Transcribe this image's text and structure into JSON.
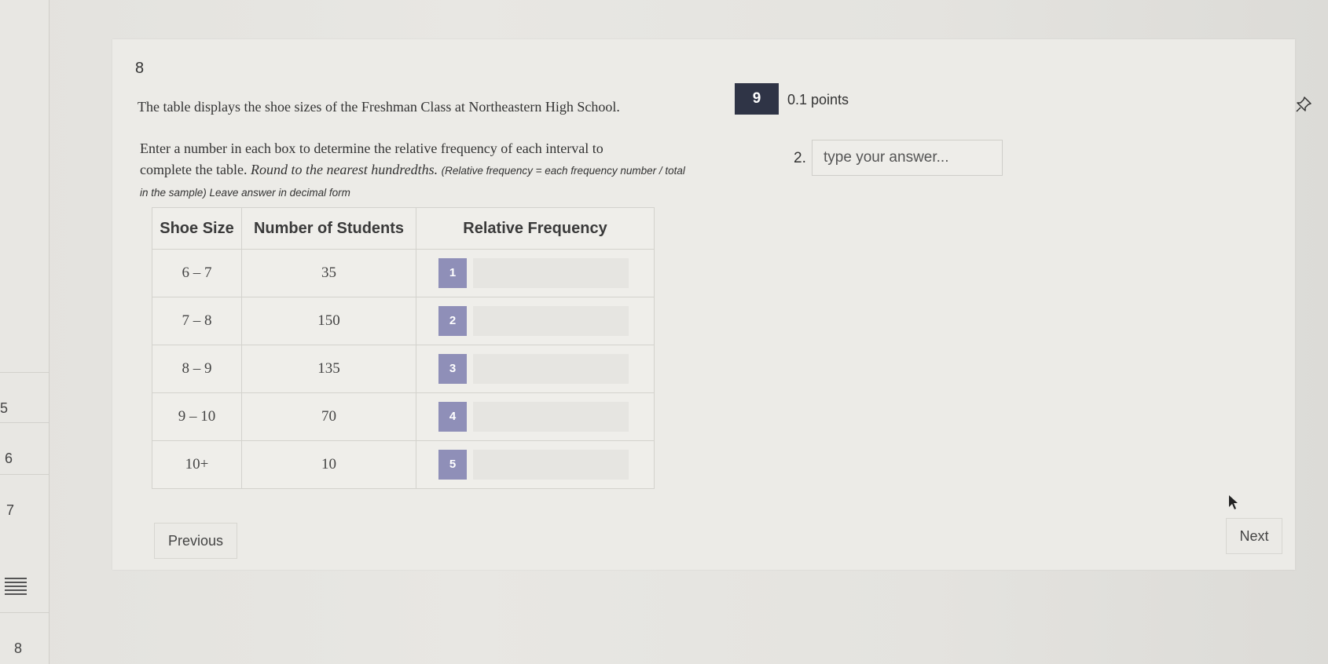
{
  "rail": {
    "items": [
      {
        "label": "5"
      },
      {
        "label": "6"
      },
      {
        "label": "7"
      },
      {
        "label": "8"
      }
    ]
  },
  "question": {
    "number": "8",
    "stem": "The table displays the shoe sizes of the Freshman Class at Northeastern High School.",
    "instructions_line1": "Enter a number in each box to determine the relative frequency of each interval to",
    "instructions_line2_plain": "complete the table. ",
    "instructions_line2_italic": "Round to the nearest hundredths.",
    "instructions_note": "(Relative frequency = each frequency number / total in the sample) Leave answer in decimal form"
  },
  "table": {
    "headers": [
      "Shoe Size",
      "Number of Students",
      "Relative Frequency"
    ],
    "rows": [
      {
        "size": "6 – 7",
        "students": "35",
        "blank": "1"
      },
      {
        "size": "7 – 8",
        "students": "150",
        "blank": "2"
      },
      {
        "size": "8 – 9",
        "students": "135",
        "blank": "3"
      },
      {
        "size": "9 – 10",
        "students": "70",
        "blank": "4"
      },
      {
        "size": "10+",
        "students": "10",
        "blank": "5"
      }
    ]
  },
  "next_question": {
    "number": "9",
    "points": "0.1 points",
    "answer_index": "2.",
    "answer_placeholder": "type your answer..."
  },
  "nav": {
    "previous_label": "Previous",
    "next_label": "Next"
  },
  "colors": {
    "badge_dark": "#2f3446",
    "blank_number": "#8f8fb8"
  }
}
